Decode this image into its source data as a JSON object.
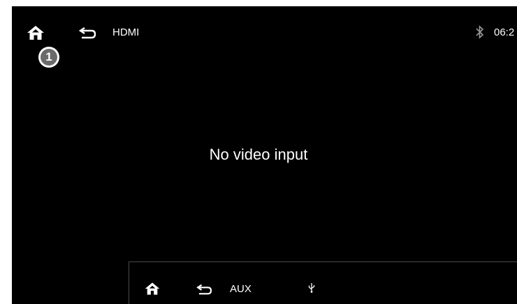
{
  "topbar": {
    "home_icon": "home-icon",
    "back_icon": "back-arrow-icon",
    "title": "HDMI",
    "bluetooth_icon": "bluetooth-icon",
    "time": "06:2"
  },
  "badge": {
    "number": "1"
  },
  "main": {
    "message": "No video input"
  },
  "overlay": {
    "home_icon": "home-icon",
    "back_icon": "back-arrow-icon",
    "title": "AUX",
    "usb_icon": "usb-icon"
  },
  "colors": {
    "screen_bg": "#000000",
    "text": "#ffffff",
    "badge_bg": "#6a6a6a"
  }
}
